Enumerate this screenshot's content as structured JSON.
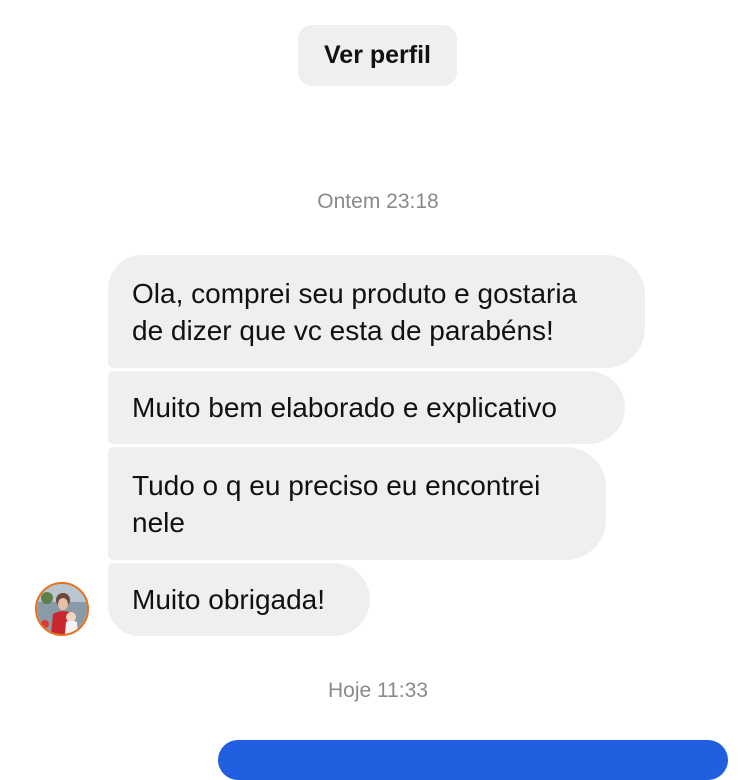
{
  "header": {
    "view_profile_label": "Ver perfil"
  },
  "conversation": {
    "timestamp_1": "Ontem 23:18",
    "messages": [
      {
        "lines": [
          "Ola, comprei seu produto e gostaria",
          "de dizer que vc esta de parabéns!"
        ]
      },
      {
        "lines": [
          "Muito bem elaborado e explicativo"
        ]
      },
      {
        "lines": [
          "Tudo o q eu preciso eu encontrei",
          "nele"
        ]
      },
      {
        "lines": [
          "Muito obrigada!"
        ]
      }
    ],
    "timestamp_2": "Hoje 11:33"
  },
  "colors": {
    "incoming_bubble": "#efefef",
    "outgoing_bubble": "#1f5fe0",
    "timestamp_text": "#8a8a8a",
    "avatar_ring": "#e8701a"
  },
  "icons": {
    "avatar": "avatar-photo"
  }
}
